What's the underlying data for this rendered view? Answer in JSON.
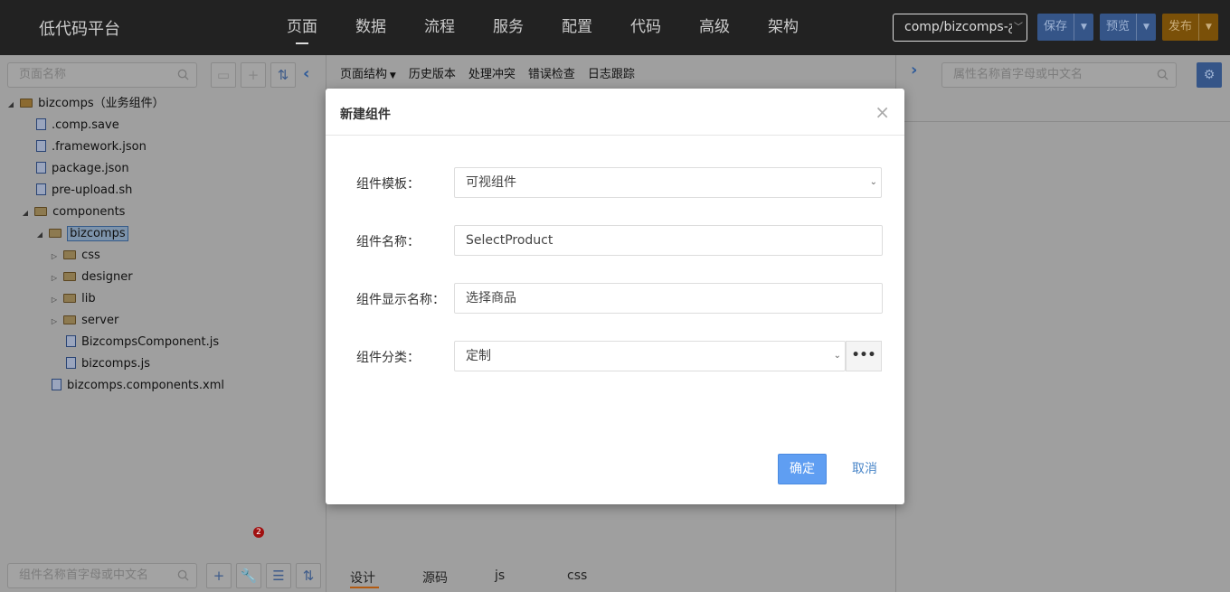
{
  "app": {
    "title": "低代码平台"
  },
  "nav": {
    "items": [
      "页面",
      "数据",
      "流程",
      "服务",
      "配置",
      "代码",
      "高级",
      "架构"
    ],
    "active": "页面"
  },
  "path_select": {
    "value": "comp/bizcomps-ᵹ"
  },
  "buttons": {
    "save": "保存",
    "preview": "预览",
    "publish": "发布"
  },
  "left_panel": {
    "search_placeholder": "页面名称",
    "bottom_search_placeholder": "组件名称首字母或中文名",
    "badge_count": "2",
    "tree": [
      {
        "label": "bizcomps（业务组件）",
        "type": "root",
        "expanded": true
      },
      {
        "label": ".comp.save",
        "type": "file"
      },
      {
        "label": ".framework.json",
        "type": "file"
      },
      {
        "label": "package.json",
        "type": "file"
      },
      {
        "label": "pre-upload.sh",
        "type": "file"
      },
      {
        "label": "components",
        "type": "folder",
        "expanded": true
      },
      {
        "label": "bizcomps",
        "type": "folder",
        "expanded": true,
        "selected": true
      },
      {
        "label": "css",
        "type": "folder"
      },
      {
        "label": "designer",
        "type": "folder"
      },
      {
        "label": "lib",
        "type": "folder"
      },
      {
        "label": "server",
        "type": "folder"
      },
      {
        "label": "BizcompsComponent.js",
        "type": "file"
      },
      {
        "label": "bizcomps.js",
        "type": "file"
      },
      {
        "label": "bizcomps.components.xml",
        "type": "file"
      }
    ]
  },
  "center": {
    "tabs": [
      "页面结构",
      "历史版本",
      "处理冲突",
      "错误检查",
      "日志跟踪"
    ],
    "bottom_tabs": [
      "设计",
      "源码",
      "js",
      "css"
    ]
  },
  "right_panel": {
    "search_placeholder": "属性名称首字母或中文名"
  },
  "modal": {
    "title": "新建组件",
    "fields": [
      {
        "label": "组件模板：",
        "value": "可视组件",
        "kind": "select"
      },
      {
        "label": "组件名称：",
        "value": "SelectProduct",
        "kind": "input"
      },
      {
        "label": "组件显示名称：",
        "value": "选择商品",
        "kind": "input"
      },
      {
        "label": "组件分类：",
        "value": "定制",
        "kind": "select"
      }
    ],
    "more_label": "•••",
    "ok": "确定",
    "cancel": "取消"
  },
  "colors": {
    "topbar": "#222222",
    "accent": "#5f9ef2",
    "save": "#355588",
    "publish": "#7a5008"
  }
}
